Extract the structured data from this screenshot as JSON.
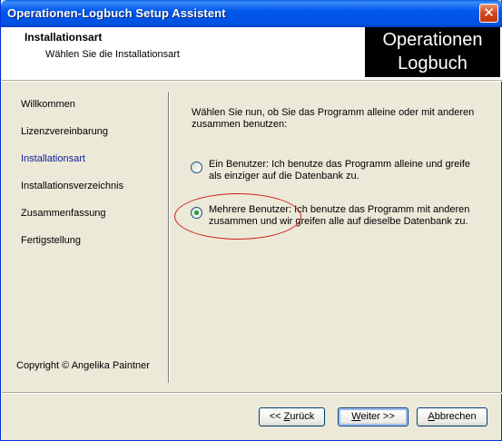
{
  "window": {
    "title": "Operationen-Logbuch Setup Assistent",
    "close_label": "✕"
  },
  "header": {
    "title": "Installationsart",
    "subtitle": "Wählen Sie die Installationsart",
    "logo_line1": "Operationen",
    "logo_line2": "Logbuch"
  },
  "sidebar": {
    "items": [
      {
        "label": "Willkommen"
      },
      {
        "label": "Lizenzvereinbarung"
      },
      {
        "label": "Installationsart"
      },
      {
        "label": "Installationsverzeichnis"
      },
      {
        "label": "Zusammenfassung"
      },
      {
        "label": "Fertigstellung"
      }
    ],
    "active_index": 2,
    "copyright": "Copyright © Angelika Paintner"
  },
  "main": {
    "intro": "Wählen Sie nun, ob Sie das Programm alleine oder mit anderen zusammen benutzen:",
    "options": [
      {
        "label": "Ein Benutzer: Ich benutze das Programm alleine und greife als einziger auf die Datenbank zu.",
        "selected": false
      },
      {
        "label": "Mehrere Benutzer: Ich benutze das Programm mit anderen zusammen und wir greifen alle auf dieselbe Datenbank zu.",
        "selected": true
      }
    ]
  },
  "buttons": {
    "back_prefix": "<< ",
    "back_accel": "Z",
    "back_rest": "urück",
    "next_accel": "W",
    "next_rest": "eiter >>",
    "cancel_accel": "A",
    "cancel_rest": "bbrechen"
  },
  "colors": {
    "titlebar": "#0058ee",
    "active_nav": "#10229a",
    "highlight_ellipse": "#d21c1c",
    "radio_dot": "#21a121"
  }
}
